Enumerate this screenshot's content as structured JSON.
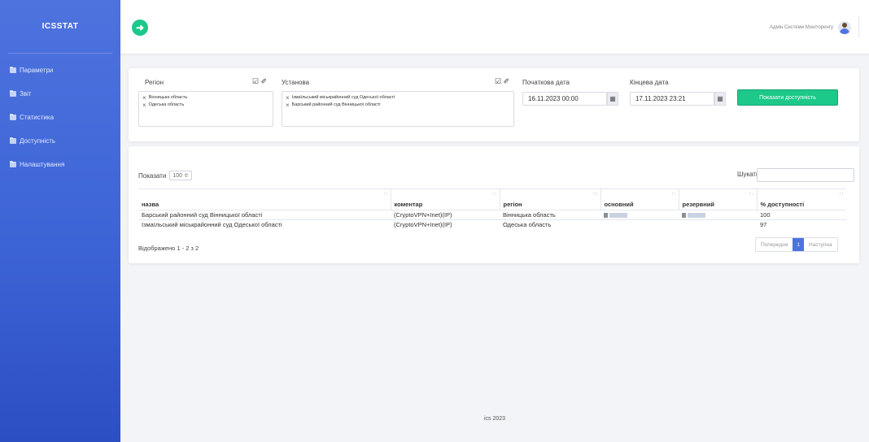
{
  "app": {
    "brand": "ICSSTAT"
  },
  "sidebar": {
    "items": [
      {
        "label": "Параметри",
        "icon": "folder-icon"
      },
      {
        "label": "Звіт",
        "icon": "folder-icon"
      },
      {
        "label": "Статистика",
        "icon": "folder-icon"
      },
      {
        "label": "Доступність",
        "icon": "folder-icon"
      },
      {
        "label": "Налаштування",
        "icon": "folder-icon"
      }
    ]
  },
  "topbar": {
    "back_icon": "arrow-left-icon",
    "user_name": "Адмін Системи Моніторингу"
  },
  "filters": {
    "region": {
      "label": "Регіон",
      "tags": [
        "Вінницька область",
        "Одеська область"
      ]
    },
    "institution": {
      "label": "Установа",
      "tags": [
        "Ізмаїльський міськрайонний суд Одеської області",
        "Барський районний суд Вінницької області"
      ]
    },
    "start": {
      "label": "Початкова дата",
      "value": "16.11.2023 00:00"
    },
    "end": {
      "label": "Кінцева дата",
      "value": "17.11.2023 23:21"
    },
    "show_button": "Показати доступність",
    "check_icon": "☑",
    "clear_icon": "✐"
  },
  "table": {
    "show_label": "Показати",
    "page_size": "100 ≑",
    "search_label": "Шукати:",
    "columns": [
      "назва",
      "коментар",
      "регіон",
      "основний",
      "резервний",
      "% доступності"
    ],
    "rows": [
      {
        "name": "Барський районний суд Вінницької області",
        "comment": "(CryptoVPN+Inet)(IP)",
        "region": "Вінницька область",
        "availability": "100"
      },
      {
        "name": "Ізмаїльський міськрайонний суд Одеської області",
        "comment": "(CryptoVPN+Inet)(IP)",
        "region": "Одеська область",
        "availability": "97"
      }
    ],
    "info": "Відображено 1 - 2 з 2",
    "prev": "Попередня",
    "page": "1",
    "next": "Наступна"
  },
  "footer": "ics 2023"
}
